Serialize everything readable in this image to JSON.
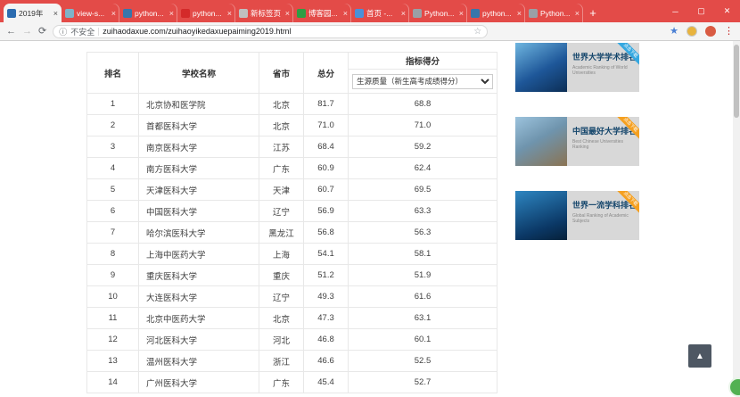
{
  "browser": {
    "tabs": [
      {
        "title": "2019年",
        "favicon_color": "#2b6cb0",
        "active": true
      },
      {
        "title": "view-s...",
        "favicon_color": "#7fb3c8",
        "active": false
      },
      {
        "title": "python...",
        "favicon_color": "#3776ab",
        "active": false
      },
      {
        "title": "python...",
        "favicon_color": "#d42a2a",
        "active": false
      },
      {
        "title": "新标签页",
        "favicon_color": "#c0c0c0",
        "active": false
      },
      {
        "title": "博客园...",
        "favicon_color": "#2f9e44",
        "active": false
      },
      {
        "title": "首页 -...",
        "favicon_color": "#4a90d9",
        "active": false
      },
      {
        "title": "Python...",
        "favicon_color": "#9aa0a6",
        "active": false
      },
      {
        "title": "python...",
        "favicon_color": "#3776ab",
        "active": false
      },
      {
        "title": "Python...",
        "favicon_color": "#9aa0a6",
        "active": false
      }
    ],
    "window_controls": {
      "minimize": "─",
      "maximize": "▢",
      "close": "✕"
    },
    "address": {
      "security_label": "不安全",
      "url": "zuihaodaxue.com/zuihaoyikedaxuepaiming2019.html"
    }
  },
  "icons": {
    "back": "←",
    "forward": "→",
    "refresh": "⟳",
    "info": "ⓘ",
    "bookmark_star": "☆",
    "extension": "★",
    "menu": "⋮",
    "new_tab": "+",
    "close_tab": "×",
    "back_to_top": "▲"
  },
  "table": {
    "headers": {
      "rank": "排名",
      "name": "学校名称",
      "province": "省市",
      "score": "总分",
      "indicator": "指标得分"
    },
    "indicator_select": "生源质量（新生高考成绩得分）",
    "rows": [
      {
        "rank": "1",
        "name": "北京协和医学院",
        "province": "北京",
        "score": "81.7",
        "indicator": "68.8"
      },
      {
        "rank": "2",
        "name": "首都医科大学",
        "province": "北京",
        "score": "71.0",
        "indicator": "71.0"
      },
      {
        "rank": "3",
        "name": "南京医科大学",
        "province": "江苏",
        "score": "68.4",
        "indicator": "59.2"
      },
      {
        "rank": "4",
        "name": "南方医科大学",
        "province": "广东",
        "score": "60.9",
        "indicator": "62.4"
      },
      {
        "rank": "5",
        "name": "天津医科大学",
        "province": "天津",
        "score": "60.7",
        "indicator": "69.5"
      },
      {
        "rank": "6",
        "name": "中国医科大学",
        "province": "辽宁",
        "score": "56.9",
        "indicator": "63.3"
      },
      {
        "rank": "7",
        "name": "哈尔滨医科大学",
        "province": "黑龙江",
        "score": "56.8",
        "indicator": "56.3"
      },
      {
        "rank": "8",
        "name": "上海中医药大学",
        "province": "上海",
        "score": "54.1",
        "indicator": "58.1"
      },
      {
        "rank": "9",
        "name": "重庆医科大学",
        "province": "重庆",
        "score": "51.2",
        "indicator": "51.9"
      },
      {
        "rank": "10",
        "name": "大连医科大学",
        "province": "辽宁",
        "score": "49.3",
        "indicator": "61.6"
      },
      {
        "rank": "11",
        "name": "北京中医药大学",
        "province": "北京",
        "score": "47.3",
        "indicator": "63.1"
      },
      {
        "rank": "12",
        "name": "河北医科大学",
        "province": "河北",
        "score": "46.8",
        "indicator": "60.1"
      },
      {
        "rank": "13",
        "name": "温州医科大学",
        "province": "浙江",
        "score": "46.6",
        "indicator": "52.5"
      },
      {
        "rank": "14",
        "name": "广州医科大学",
        "province": "广东",
        "score": "45.4",
        "indicator": "52.7"
      }
    ]
  },
  "sidebar": {
    "banners": [
      {
        "title": "世界大学学术排名",
        "subtitle": "Academic Ranking of World Universities",
        "ribbon": "点击下载",
        "ribbon_color": "#35a8e0"
      },
      {
        "title": "中国最好大学排名",
        "subtitle": "Best Chinese Universities Ranking",
        "ribbon": "点击下载",
        "ribbon_color": "#f5a020"
      },
      {
        "title": "世界一流学科排名",
        "subtitle": "Global Ranking of Academic Subjects",
        "ribbon": "点击下载",
        "ribbon_color": "#f5a020"
      }
    ]
  }
}
